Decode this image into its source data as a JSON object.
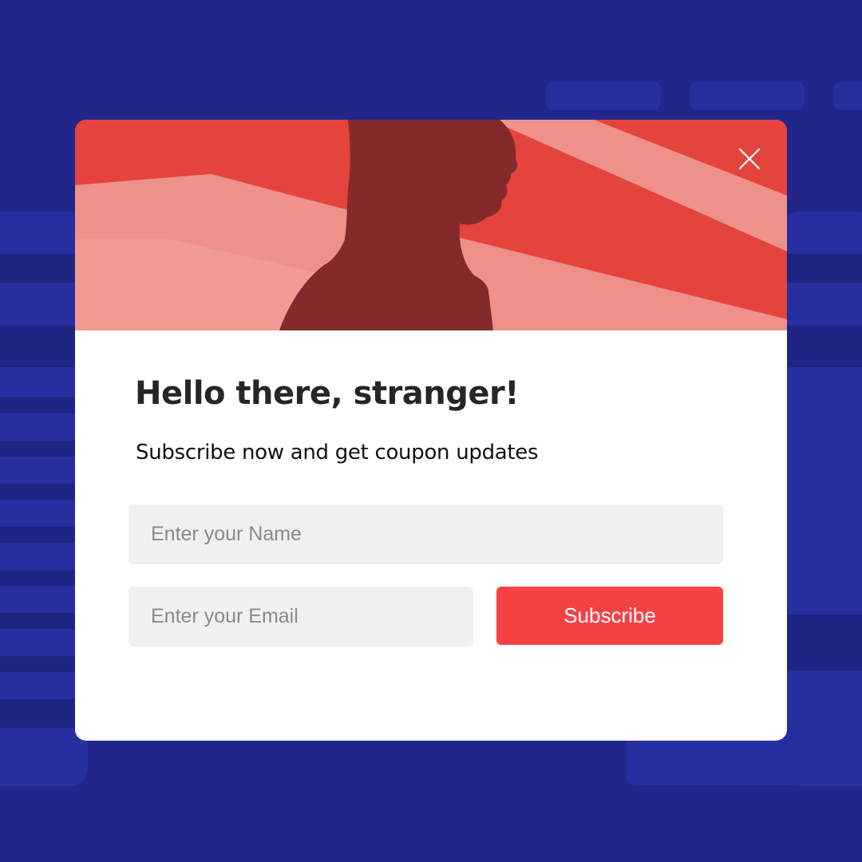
{
  "colors": {
    "background": "#22268b",
    "hero": "#e5443e",
    "accent": "#f44244",
    "title": "#262626"
  },
  "popup": {
    "title": "Hello there, stranger!",
    "subtitle": "Subscribe now and get coupon updates",
    "close_icon": "close-icon",
    "name_input": {
      "placeholder": "Enter your Name",
      "value": ""
    },
    "email_input": {
      "placeholder": "Enter your Email",
      "value": ""
    },
    "subscribe_label": "Subscribe"
  }
}
